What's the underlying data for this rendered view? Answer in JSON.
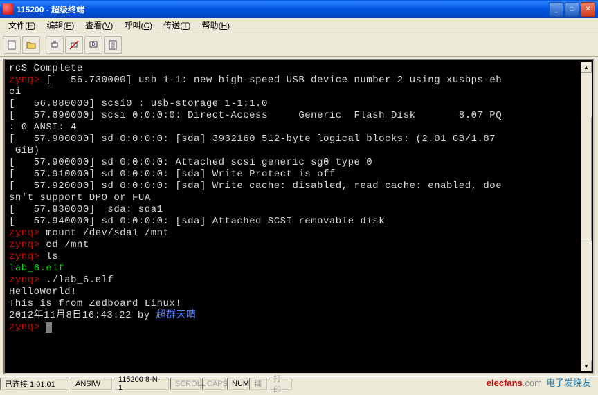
{
  "window": {
    "title": "115200 - 超级终端"
  },
  "menu": {
    "items": [
      {
        "label": "文件",
        "key": "F"
      },
      {
        "label": "编辑",
        "key": "E"
      },
      {
        "label": "查看",
        "key": "V"
      },
      {
        "label": "呼叫",
        "key": "C"
      },
      {
        "label": "传送",
        "key": "T"
      },
      {
        "label": "帮助",
        "key": "H"
      }
    ]
  },
  "toolbar": {
    "icons": [
      "new-file",
      "open-file",
      "connect",
      "disconnect",
      "send",
      "properties"
    ]
  },
  "terminal": {
    "lines": [
      {
        "spans": [
          {
            "t": "rcS Complete",
            "c": ""
          }
        ]
      },
      {
        "spans": [
          {
            "t": "zynq>",
            "c": "red"
          },
          {
            "t": " [   56.730000] usb 1-1: new high-speed USB device number 2 using xusbps-eh",
            "c": ""
          }
        ]
      },
      {
        "spans": [
          {
            "t": "ci",
            "c": ""
          }
        ]
      },
      {
        "spans": [
          {
            "t": "[   56.880000] scsi0 : usb-storage 1-1:1.0",
            "c": ""
          }
        ]
      },
      {
        "spans": [
          {
            "t": "[   57.890000] scsi 0:0:0:0: Direct-Access     Generic  Flash Disk       8.07 PQ",
            "c": ""
          }
        ]
      },
      {
        "spans": [
          {
            "t": ": 0 ANSI: 4",
            "c": ""
          }
        ]
      },
      {
        "spans": [
          {
            "t": "[   57.900000] sd 0:0:0:0: [sda] 3932160 512-byte logical blocks: (2.01 GB/1.87",
            "c": ""
          }
        ]
      },
      {
        "spans": [
          {
            "t": " GiB)",
            "c": ""
          }
        ]
      },
      {
        "spans": [
          {
            "t": "[   57.900000] sd 0:0:0:0: Attached scsi generic sg0 type 0",
            "c": ""
          }
        ]
      },
      {
        "spans": [
          {
            "t": "[   57.910000] sd 0:0:0:0: [sda] Write Protect is off",
            "c": ""
          }
        ]
      },
      {
        "spans": [
          {
            "t": "[   57.920000] sd 0:0:0:0: [sda] Write cache: disabled, read cache: enabled, doe",
            "c": ""
          }
        ]
      },
      {
        "spans": [
          {
            "t": "sn't support DPO or FUA",
            "c": ""
          }
        ]
      },
      {
        "spans": [
          {
            "t": "[   57.930000]  sda: sda1",
            "c": ""
          }
        ]
      },
      {
        "spans": [
          {
            "t": "[   57.940000] sd 0:0:0:0: [sda] Attached SCSI removable disk",
            "c": ""
          }
        ]
      },
      {
        "spans": [
          {
            "t": "",
            "c": ""
          }
        ]
      },
      {
        "spans": [
          {
            "t": "zynq>",
            "c": "red"
          },
          {
            "t": " mount /dev/sda1 /mnt",
            "c": ""
          }
        ]
      },
      {
        "spans": [
          {
            "t": "zynq>",
            "c": "red"
          },
          {
            "t": " cd /mnt",
            "c": ""
          }
        ]
      },
      {
        "spans": [
          {
            "t": "zynq>",
            "c": "red"
          },
          {
            "t": " ls",
            "c": ""
          }
        ]
      },
      {
        "spans": [
          {
            "t": "lab_6.elf",
            "c": "green"
          }
        ]
      },
      {
        "spans": [
          {
            "t": "zynq>",
            "c": "red"
          },
          {
            "t": " ./lab_6.elf",
            "c": ""
          }
        ]
      },
      {
        "spans": [
          {
            "t": "HelloWorld!",
            "c": ""
          }
        ]
      },
      {
        "spans": [
          {
            "t": "This is from Zedboard Linux!",
            "c": ""
          }
        ]
      },
      {
        "spans": [
          {
            "t": "2012年11月8日16:43:22 by ",
            "c": ""
          },
          {
            "t": "超群天晴",
            "c": "blue"
          }
        ]
      },
      {
        "spans": [
          {
            "t": "zynq>",
            "c": "red"
          },
          {
            "t": " ",
            "c": ""
          }
        ],
        "cursor": true
      }
    ]
  },
  "status": {
    "connected": "已连接 1:01:01",
    "emulation": "ANSIW",
    "params": "115200 8-N-1",
    "scroll": "SCROLL",
    "caps": "CAPS",
    "num": "NUM",
    "capture": "捕",
    "print": "打印"
  },
  "watermark": {
    "brand": "elecfans",
    "domain": ".com",
    "cn": "电子发烧友"
  },
  "colors": {
    "titlebar": "#0054e0",
    "prompt": "#d00000",
    "executable": "#00e000",
    "highlight": "#5080ff"
  }
}
